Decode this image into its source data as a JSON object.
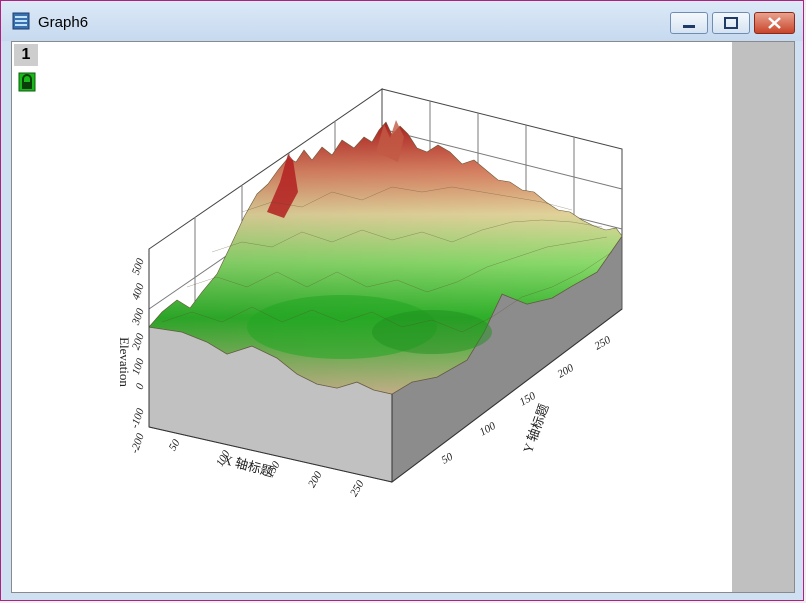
{
  "window": {
    "title": "Graph6",
    "controls": [
      "minimize",
      "maximize",
      "close"
    ]
  },
  "graph": {
    "layer_label": "1",
    "lock_icon": "lock-icon",
    "z_axis_title": "Elevation",
    "x_axis_title": "X 轴标题",
    "y_axis_title": "Y 轴标题",
    "z_ticks": [
      "-200",
      "-100",
      "0",
      "100",
      "200",
      "300",
      "400",
      "500"
    ],
    "x_ticks": [
      "50",
      "100",
      "150",
      "200",
      "250"
    ],
    "y_ticks": [
      "50",
      "100",
      "150",
      "200",
      "250"
    ]
  },
  "colors": {
    "low": "#19a519",
    "mid": "#d8cb93",
    "high": "#b32020",
    "side_front": "#c1c1c1",
    "side_right": "#8c8c8c"
  }
}
